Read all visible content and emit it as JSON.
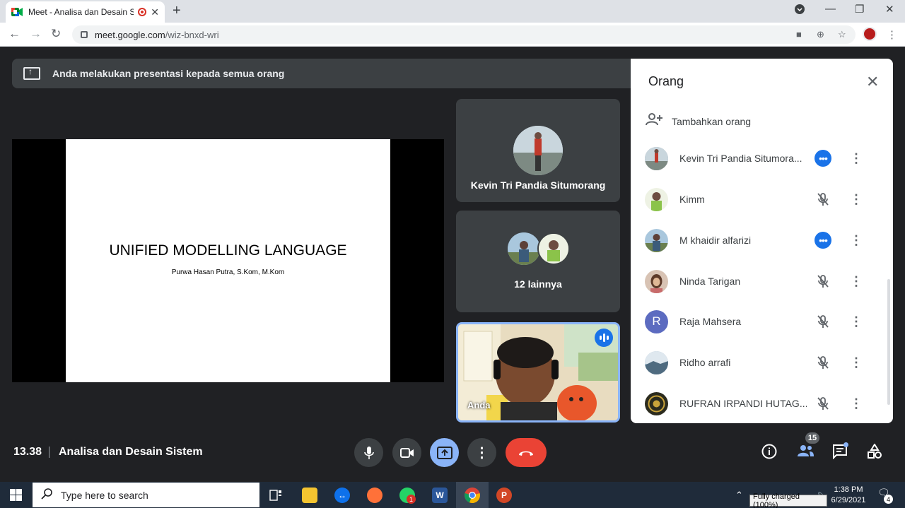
{
  "browser": {
    "tab_title": "Meet - Analisa dan Desain Si",
    "url_host": "meet.google.com",
    "url_path": "/wiz-bnxd-wri"
  },
  "banner": {
    "text": "Anda melakukan presentasi kepada semua orang"
  },
  "slide": {
    "title": "UNIFIED MODELLING LANGUAGE",
    "subtitle": "Purwa Hasan Putra, S.Kom, M.Kom"
  },
  "tiles": {
    "kevin": "Kevin Tri Pandia Situmorang",
    "others": "12 lainnya",
    "self": "Anda"
  },
  "panel": {
    "title": "Orang",
    "add_people": "Tambahkan orang",
    "people": [
      {
        "name": "Kevin Tri Pandia Situmora...",
        "status": "more-options",
        "avatar_color": "#8d9aa6"
      },
      {
        "name": "Kimm",
        "status": "muted",
        "avatar_color": "#7aa05a"
      },
      {
        "name": "M khaidir alfarizi",
        "status": "more-options",
        "avatar_color": "#4e6f8f"
      },
      {
        "name": "Ninda Tarigan",
        "status": "muted",
        "avatar_color": "#c9a58a"
      },
      {
        "name": "Raja Mahsera",
        "status": "muted",
        "avatar_letter": "R",
        "avatar_color": "#5c6bc0"
      },
      {
        "name": "Ridho arrafi",
        "status": "muted",
        "avatar_color": "#6f8aa3"
      },
      {
        "name": "RUFRAN IRPANDI HUTAG...",
        "status": "muted",
        "avatar_color": "#2b2b1e"
      }
    ]
  },
  "bottom": {
    "time": "13.38",
    "meeting_title": "Analisa dan Desain Sistem",
    "people_count": "15"
  },
  "taskbar": {
    "search_placeholder": "Type here to search",
    "clock_time": "1:38 PM",
    "clock_date": "6/29/2021",
    "battery_tooltip": "Fully charged (100%)",
    "whatsapp_badge": "1",
    "notification_count": "4"
  },
  "colors": {
    "meet_bg": "#202124",
    "accent_blue": "#1a73e8",
    "present_blue": "#8ab4f8",
    "end_call_red": "#ea4335"
  }
}
